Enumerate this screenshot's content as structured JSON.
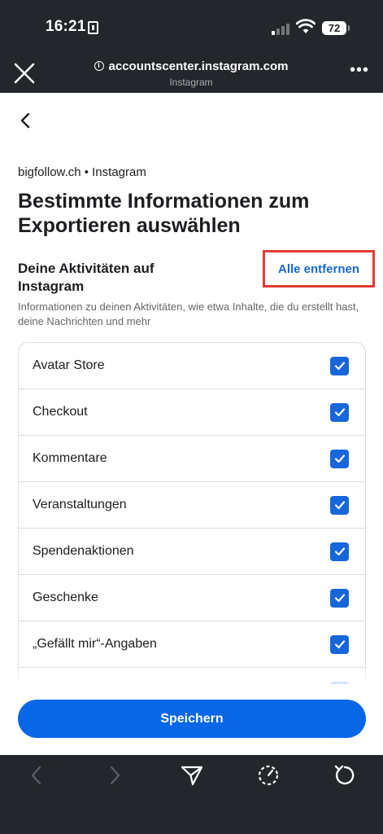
{
  "status_bar": {
    "time": "16:21",
    "battery": "72"
  },
  "browser": {
    "url": "accountscenter.instagram.com",
    "site_name": "Instagram"
  },
  "page": {
    "account": "bigfollow.ch • Instagram",
    "title": "Bestimmte Informationen zum Exportieren auswählen",
    "section_title": "Deine Aktivitäten auf Instagram",
    "remove_all": "Alle entfernen",
    "section_description": "Informationen zu deinen Aktivitäten, wie etwa Inhalte, die du erstellt hast, deine Nachrichten und mehr",
    "items": [
      {
        "label": "Avatar Store",
        "checked": true
      },
      {
        "label": "Checkout",
        "checked": true
      },
      {
        "label": "Kommentare",
        "checked": true
      },
      {
        "label": "Veranstaltungen",
        "checked": true
      },
      {
        "label": "Spendenaktionen",
        "checked": true
      },
      {
        "label": "Geschenke",
        "checked": true
      },
      {
        "label": "„Gefällt mir“-Angaben",
        "checked": true
      },
      {
        "label": "",
        "checked": true
      }
    ],
    "save_label": "Speichern"
  },
  "icons": {
    "close": "close-icon",
    "info": "info-icon",
    "more": "more-icon",
    "back": "chevron-left-icon",
    "checkbox": "checkmark-icon",
    "nav_back": "arrow-left-icon",
    "nav_forward": "arrow-right-icon",
    "share": "send-icon",
    "loading": "loading-icon",
    "reload": "reload-icon"
  },
  "colors": {
    "accent": "#0867e6",
    "link": "#1867d8",
    "highlight_box": "#e23b36",
    "chrome": "#23262a"
  }
}
